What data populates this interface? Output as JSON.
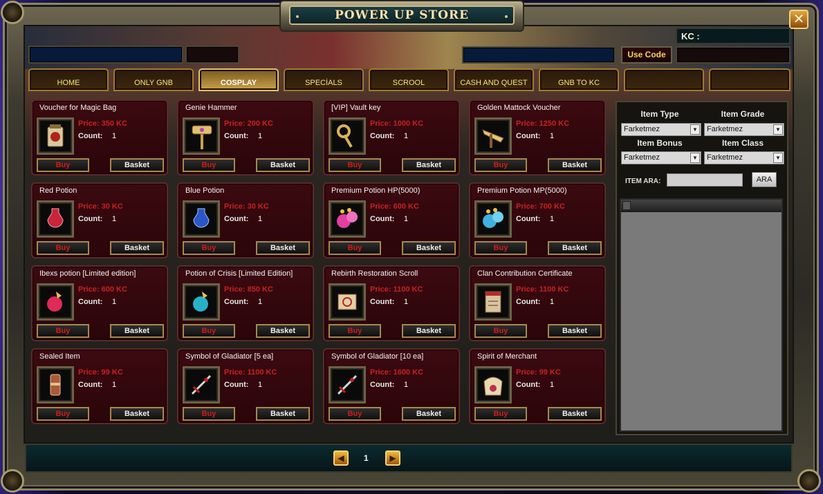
{
  "window": {
    "title": "POWER UP STORE"
  },
  "header": {
    "kc_label": "KC :",
    "use_code_label": "Use Code"
  },
  "tabs": [
    {
      "label": "HOME",
      "active": false
    },
    {
      "label": "ONLY GNB",
      "active": false
    },
    {
      "label": "COSPLAY",
      "active": true
    },
    {
      "label": "SPECİALS",
      "active": false
    },
    {
      "label": "SCROOL",
      "active": false
    },
    {
      "label": "CASH AND QUEST",
      "active": false
    },
    {
      "label": "GNB TO KC",
      "active": false
    },
    {
      "label": "",
      "active": false
    },
    {
      "label": "",
      "active": false
    }
  ],
  "card_labels": {
    "count_label": "Count:",
    "buy": "Buy",
    "basket": "Basket"
  },
  "items": [
    {
      "name": "Voucher for Magic Bag",
      "price": "Price: 350 KC",
      "count": "1",
      "icon": "magic-bag-voucher-icon"
    },
    {
      "name": "Genie Hammer",
      "price": "Price: 200 KC",
      "count": "1",
      "icon": "hammer-icon"
    },
    {
      "name": "[VIP] Vault key",
      "price": "Price: 1000 KC",
      "count": "1",
      "icon": "key-icon"
    },
    {
      "name": "Golden Mattock Voucher",
      "price": "Price: 1250 KC",
      "count": "1",
      "icon": "mattock-icon"
    },
    {
      "name": "Red Potion",
      "price": "Price: 30 KC",
      "count": "1",
      "icon": "red-potion-icon"
    },
    {
      "name": "Blue Potion",
      "price": "Price: 30 KC",
      "count": "1",
      "icon": "blue-potion-icon"
    },
    {
      "name": "Premium Potion HP(5000)",
      "price": "Price: 600 KC",
      "count": "1",
      "icon": "premium-hp-potion-icon"
    },
    {
      "name": "Premium Potion MP(5000)",
      "price": "Price: 700 KC",
      "count": "1",
      "icon": "premium-mp-potion-icon"
    },
    {
      "name": "Ibexs potion [Limited edition]",
      "price": "Price: 600 KC",
      "count": "1",
      "icon": "ibexs-potion-icon"
    },
    {
      "name": "Potion of Crisis [Limited Edition]",
      "price": "Price: 850 KC",
      "count": "1",
      "icon": "crisis-potion-icon"
    },
    {
      "name": "Rebirth Restoration Scroll",
      "price": "Price: 1100 KC",
      "count": "1",
      "icon": "scroll-icon"
    },
    {
      "name": "Clan Contribution Certificate",
      "price": "Price: 1100 KC",
      "count": "1",
      "icon": "certificate-icon"
    },
    {
      "name": "Sealed Item",
      "price": "Price: 99 KC",
      "count": "1",
      "icon": "sealed-item-icon"
    },
    {
      "name": "Symbol of Gladiator [5 ea]",
      "price": "Price: 1100 KC",
      "count": "1",
      "icon": "sword-icon"
    },
    {
      "name": "Symbol of Gladiator [10 ea]",
      "price": "Price: 1600 KC",
      "count": "1",
      "icon": "sword-icon"
    },
    {
      "name": "Spirit of Merchant",
      "price": "Price: 99 KC",
      "count": "1",
      "icon": "merchant-spirit-icon"
    }
  ],
  "filters": {
    "item_type": {
      "label": "Item Type",
      "value": "Farketmez"
    },
    "item_grade": {
      "label": "Item Grade",
      "value": "Farketmez"
    },
    "item_bonus": {
      "label": "Item Bonus",
      "value": "Farketmez"
    },
    "item_class": {
      "label": "Item Class",
      "value": "Farketmez"
    },
    "search_label": "ITEM ARA:",
    "search_button": "ARA"
  },
  "pagination": {
    "page": "1"
  },
  "colors": {
    "price": "#c92020",
    "tab_text": "#f8e67a",
    "card_bg": "#3b0a10",
    "frame": "#8c8468"
  }
}
